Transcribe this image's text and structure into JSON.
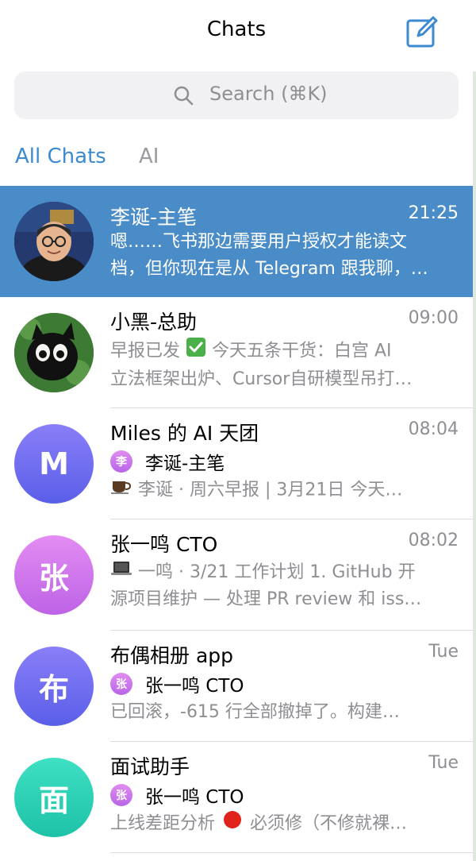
{
  "header": {
    "title": "Chats"
  },
  "search": {
    "placeholder": "Search (⌘K)"
  },
  "tabs": [
    {
      "label": "All Chats"
    },
    {
      "label": "AI"
    }
  ],
  "chats": [
    {
      "name": "李诞-主笔",
      "time": "21:25",
      "preview_line1": "嗯……飞书那边需要用户授权才能读文",
      "preview_line2": "档，但你现在是从 Telegram 跟我聊，…"
    },
    {
      "name": "小黑-总助",
      "time": "09:00",
      "preview_line1_a": "早报已发",
      "preview_line1_b": "今天五条干货：白宫 AI",
      "preview_line2": "立法框架出炉、Cursor自研模型吊打…"
    },
    {
      "name": "Miles 的 AI 天团",
      "time": "08:04",
      "avatar_letter": "M",
      "sender_initial": "李",
      "sender": "李诞-主笔",
      "preview": "李诞 · 周六早报 | 3月21日  今天…"
    },
    {
      "name": "张一鸣 CTO",
      "time": "08:02",
      "avatar_letter": "张",
      "preview_line1": "一鸣 · 3/21 工作计划  1. GitHub 开",
      "preview_line2": "源项目维护 — 处理 PR review 和 iss…"
    },
    {
      "name": "布偶相册 app",
      "time": "Tue",
      "avatar_letter": "布",
      "sender_initial": "张",
      "sender": "张一鸣 CTO",
      "preview": "已回滚，-615 行全部撤掉了。构建…"
    },
    {
      "name": "面试助手",
      "time": "Tue",
      "avatar_letter": "面",
      "sender_initial": "张",
      "sender": "张一鸣 CTO",
      "preview_a": "上线差距分析",
      "preview_b": "必须修（不修就裸…"
    }
  ],
  "colors": {
    "accent": "#3c8ad0",
    "selected_row": "#4a8cc7",
    "muted_text": "#8e8e93"
  }
}
